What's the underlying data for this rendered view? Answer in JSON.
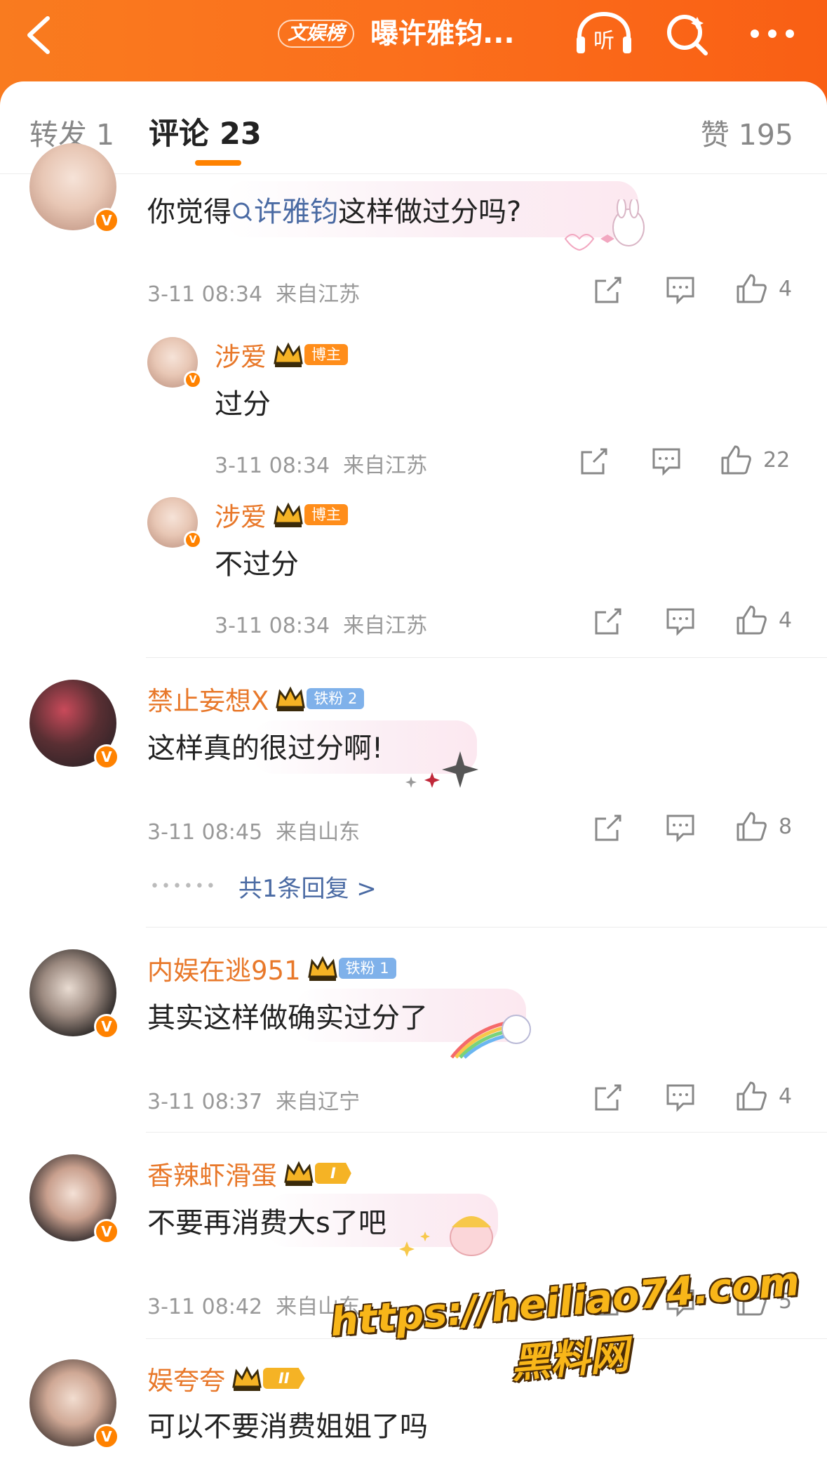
{
  "header": {
    "topic_tag": "文娱榜",
    "title": "曝许雅钧..."
  },
  "tabs": {
    "repost": "转发 1",
    "comment": "评论 23",
    "likes": "赞 195"
  },
  "comments": [
    {
      "text_prefix": "你觉得",
      "topic_link": "许雅钧",
      "text_suffix": "这样做过分吗?",
      "time": "3-11 08:34",
      "location": "来自江苏",
      "likes": "4",
      "replies": [
        {
          "user": "涉爱",
          "badge": "博主",
          "text": "过分",
          "time": "3-11 08:34",
          "location": "来自江苏",
          "likes": "22"
        },
        {
          "user": "涉爱",
          "badge": "博主",
          "text": "不过分",
          "time": "3-11 08:34",
          "location": "来自江苏",
          "likes": "4"
        }
      ]
    },
    {
      "user": "禁止妄想X",
      "badge": "铁粉 2",
      "text": "这样真的很过分啊!",
      "time": "3-11 08:45",
      "location": "来自山东",
      "likes": "8",
      "more_replies": "共1条回复 >"
    },
    {
      "user": "内娱在逃951",
      "badge": "铁粉 1",
      "text": "其实这样做确实过分了",
      "time": "3-11 08:37",
      "location": "来自辽宁",
      "likes": "4"
    },
    {
      "user": "香辣虾滑蛋",
      "badge": "I",
      "text": "不要再消费大s了吧",
      "time": "3-11 08:42",
      "location": "来自山东",
      "likes": "5"
    },
    {
      "user": "娱夸夸",
      "badge": "II",
      "text": "可以不要消费姐姐了吗"
    }
  ],
  "watermark": {
    "url": "https://heiliao74.com",
    "name": "黑料网"
  },
  "colors": {
    "brand_orange": "#ff8200",
    "username": "#e8782a",
    "link_blue": "#4a6aa3"
  },
  "icons": [
    "back-icon",
    "listen-icon",
    "search-icon",
    "more-icon",
    "share-icon",
    "comment-icon",
    "like-icon",
    "crown-icon",
    "verified-icon"
  ]
}
